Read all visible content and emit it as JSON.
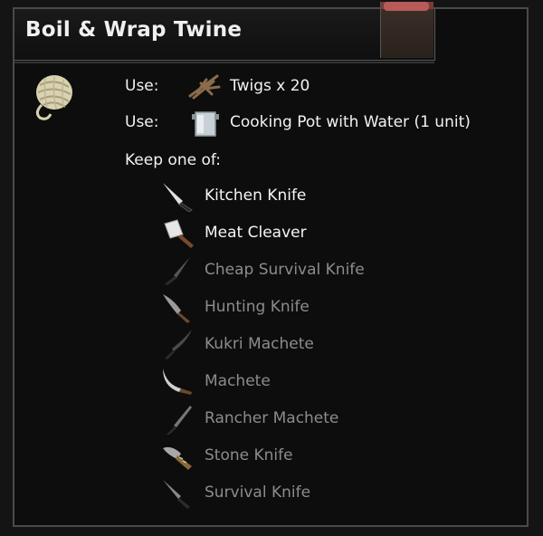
{
  "recipe": {
    "title": "Boil & Wrap Twine"
  },
  "uses": [
    {
      "label": "Use:",
      "item": "Twigs x 20",
      "icon": "twigs-icon"
    },
    {
      "label": "Use:",
      "item": "Cooking Pot with Water (1 unit)",
      "icon": "cooking-pot-icon"
    }
  ],
  "keep_label": "Keep one of:",
  "tools": [
    {
      "name": "Kitchen Knife",
      "icon": "kitchen-knife-icon",
      "available": true
    },
    {
      "name": "Meat Cleaver",
      "icon": "meat-cleaver-icon",
      "available": true
    },
    {
      "name": "Cheap Survival Knife",
      "icon": "cheap-survival-knife-icon",
      "available": false
    },
    {
      "name": "Hunting Knife",
      "icon": "hunting-knife-icon",
      "available": false
    },
    {
      "name": "Kukri Machete",
      "icon": "kukri-machete-icon",
      "available": false
    },
    {
      "name": "Machete",
      "icon": "machete-icon",
      "available": false
    },
    {
      "name": "Rancher Machete",
      "icon": "rancher-machete-icon",
      "available": false
    },
    {
      "name": "Stone Knife",
      "icon": "stone-knife-icon",
      "available": false
    },
    {
      "name": "Survival Knife",
      "icon": "survival-knife-icon",
      "available": false
    }
  ],
  "colors": {
    "available": "#f5f5f5",
    "unavailable": "#8c8c8c",
    "background": "#0d0d0d",
    "border": "#4a4a4a"
  }
}
